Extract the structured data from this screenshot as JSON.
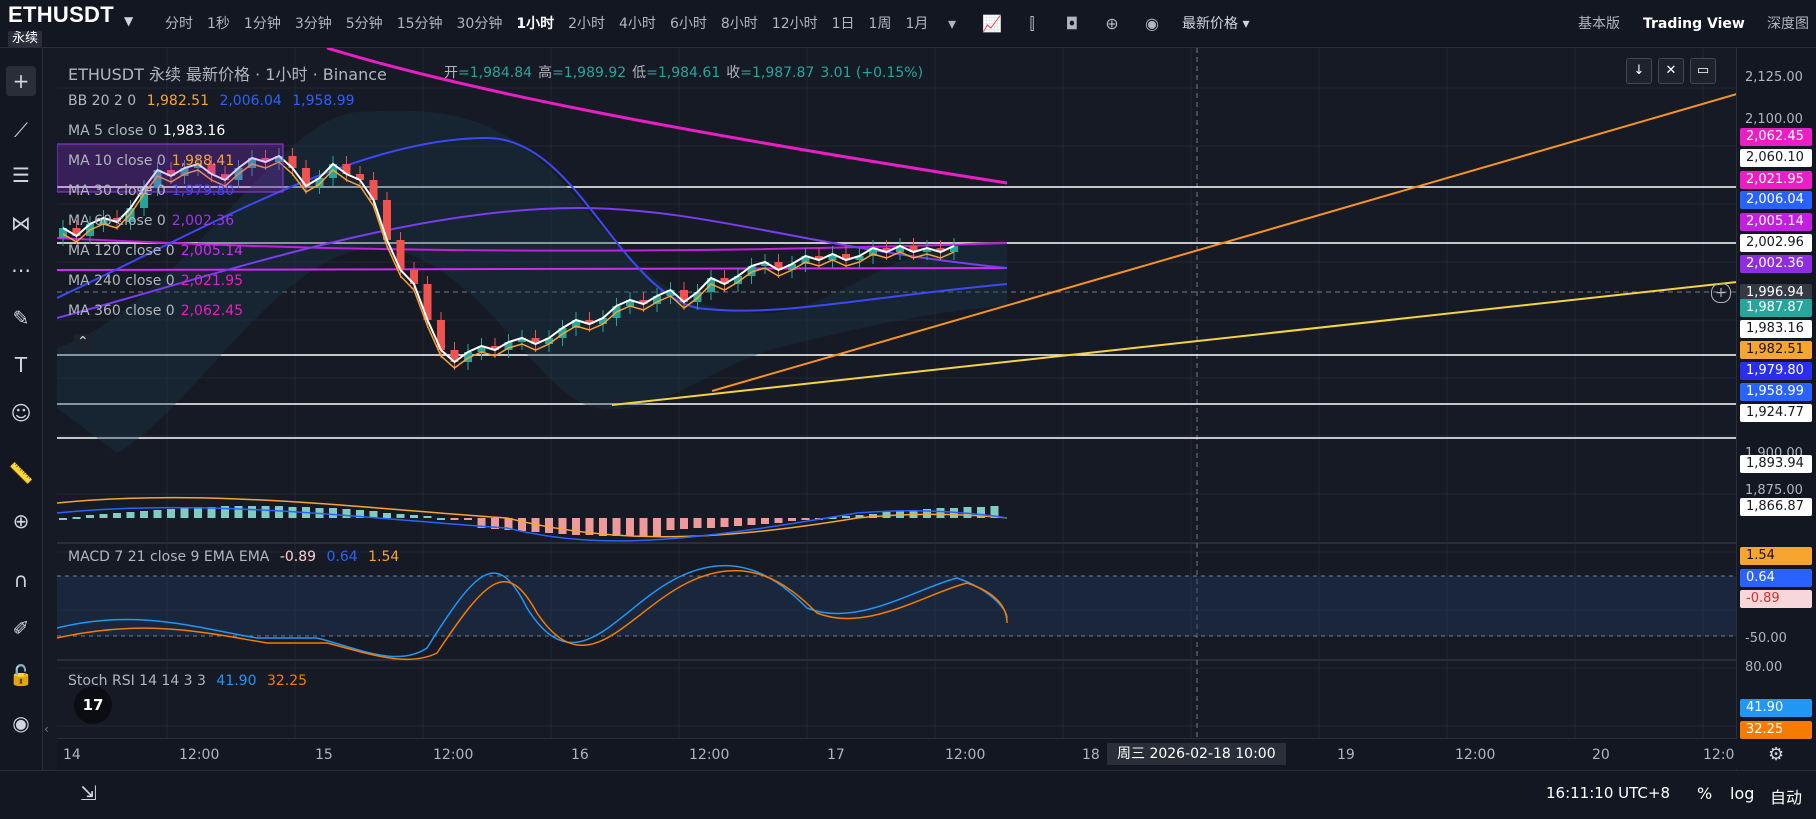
{
  "symbol": {
    "name": "ETHUSDT",
    "badge": "永续"
  },
  "intervals": [
    "分时",
    "1秒",
    "1分钟",
    "3分钟",
    "5分钟",
    "15分钟",
    "30分钟",
    "1小时",
    "2小时",
    "4小时",
    "6小时",
    "8小时",
    "12小时",
    "1日",
    "1周",
    "1月"
  ],
  "active_interval": "1小时",
  "toolbar": {
    "price_type": "最新价格 ▾",
    "view_basic": "基本版",
    "view_tv": "Trading View",
    "view_depth": "深度图"
  },
  "header": {
    "title": "ETHUSDT 永续 最新价格 · 1小时 · Binance",
    "ohlc": [
      {
        "k": "开",
        "v": "=1,984.84"
      },
      {
        "k": "高",
        "v": "=1,989.92"
      },
      {
        "k": "低",
        "v": "=1,984.61"
      },
      {
        "k": "收",
        "v": "=1,987.87"
      }
    ],
    "change": "3.01 (+0.15%)"
  },
  "legend": {
    "bb": {
      "label": "BB 20 2 0",
      "v1": "1,982.51",
      "v2": "2,006.04",
      "v3": "1,958.99"
    },
    "ma": [
      {
        "label": "MA 5 close 0",
        "value": "1,983.16",
        "color": "#ffffff"
      },
      {
        "label": "MA 10 close 0",
        "value": "1,988.41",
        "color": "#f7a531"
      },
      {
        "label": "MA 30 close 0",
        "value": "1,979.80",
        "color": "#3d49f5"
      },
      {
        "label": "MA 60 close 0",
        "value": "2,002.36",
        "color": "#9d35f0"
      },
      {
        "label": "MA 120 close 0",
        "value": "2,005.14",
        "color": "#d02bf2"
      },
      {
        "label": "MA 240 close 0",
        "value": "2,021.95",
        "color": "#e91ec4"
      },
      {
        "label": "MA 360 close 0",
        "value": "2,062.45",
        "color": "#e91ec4"
      }
    ],
    "macd": {
      "label": "MACD 7 21 close 9 EMA EMA",
      "v1": "-0.89",
      "v2": "0.64",
      "v3": "1.54"
    },
    "stoch": {
      "label": "Stoch RSI 14 14 3 3",
      "v1": "41.90",
      "v2": "32.25"
    }
  },
  "price_axis_ticks": [
    "2,125.00",
    "2,100.00",
    "1,900.00",
    "1,875.00",
    "-50.00",
    "80.00"
  ],
  "price_labels": [
    {
      "text": "2,062.45",
      "bg": "#e91ec4",
      "fg": "#ffffff"
    },
    {
      "text": "2,060.10",
      "bg": "#ffffff",
      "fg": "#131722"
    },
    {
      "text": "2,021.95",
      "bg": "#e91ec4",
      "fg": "#ffffff"
    },
    {
      "text": "2,006.04",
      "bg": "#2962ff",
      "fg": "#ffffff"
    },
    {
      "text": "2,005.14",
      "bg": "#c41ee0",
      "fg": "#ffffff"
    },
    {
      "text": "2,002.96",
      "bg": "#ffffff",
      "fg": "#131722"
    },
    {
      "text": "2,002.36",
      "bg": "#8e2ee0",
      "fg": "#ffffff"
    },
    {
      "text": "1,996.94",
      "bg": "#363a45",
      "fg": "#ffffff"
    },
    {
      "text": "1,987.87",
      "bg": "#26a69a",
      "fg": "#ffffff"
    },
    {
      "text": "1,983.16",
      "bg": "#ffffff",
      "fg": "#131722"
    },
    {
      "text": "1,982.51",
      "bg": "#f7a531",
      "fg": "#131722"
    },
    {
      "text": "1,979.80",
      "bg": "#2a2ef0",
      "fg": "#ffffff"
    },
    {
      "text": "1,958.99",
      "bg": "#2962ff",
      "fg": "#ffffff"
    },
    {
      "text": "1,924.77",
      "bg": "#ffffff",
      "fg": "#131722"
    },
    {
      "text": "1,893.94",
      "bg": "#ffffff",
      "fg": "#131722"
    },
    {
      "text": "1,866.87",
      "bg": "#ffffff",
      "fg": "#131722"
    },
    {
      "text": "1.54",
      "bg": "#f7a531",
      "fg": "#131722"
    },
    {
      "text": "0.64",
      "bg": "#2962ff",
      "fg": "#ffffff"
    },
    {
      "text": "-0.89",
      "bg": "#f8d7da",
      "fg": "#d32f2f"
    },
    {
      "text": "41.90",
      "bg": "#2196f3",
      "fg": "#ffffff"
    },
    {
      "text": "32.25",
      "bg": "#f57c00",
      "fg": "#ffffff"
    }
  ],
  "time_ticks": [
    "14",
    "12:00",
    "15",
    "12:00",
    "16",
    "12:00",
    "17",
    "12:00",
    "18",
    "19",
    "12:00",
    "20",
    "12:0"
  ],
  "crosshair_time": "周三 2026-02-18   10:00",
  "bottombar": {
    "clock": "16:11:10 UTC+8",
    "percent": "%",
    "log": "log",
    "auto": "自动"
  },
  "tv_logo": "17",
  "colors": {
    "bull": "#26a69a",
    "bear": "#ef5350",
    "ma_pink": "#e91ec4",
    "trend_orange": "#f7931e",
    "trend_yellow": "#f5d442",
    "bg": "#161a25"
  },
  "icons": [
    "crosshair-icon",
    "trendline-icon",
    "horizontal-lines-icon",
    "pattern-icon",
    "fib-icon",
    "brush-icon",
    "text-icon",
    "emoji-icon",
    "ruler-icon",
    "zoom-icon",
    "magnet-icon",
    "pencil-lock-icon",
    "lock-icon",
    "eye-icon",
    "trash-icon"
  ]
}
